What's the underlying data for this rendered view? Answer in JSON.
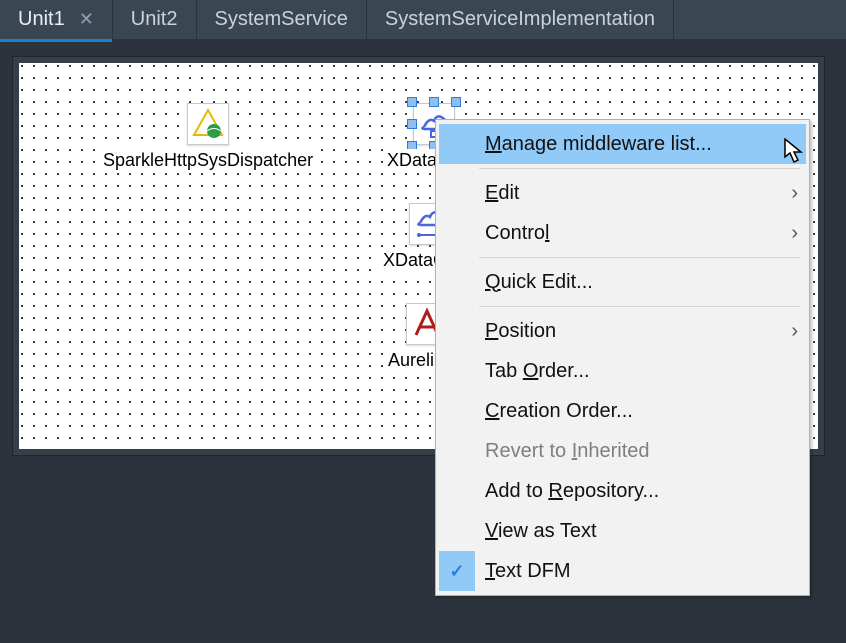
{
  "tabs": {
    "items": [
      {
        "label": "Unit1",
        "active": true,
        "closable": true
      },
      {
        "label": "Unit2",
        "active": false,
        "closable": false
      },
      {
        "label": "SystemService",
        "active": false,
        "closable": false
      },
      {
        "label": "SystemServiceImplementation",
        "active": false,
        "closable": false
      }
    ]
  },
  "designer": {
    "components": {
      "dispatcher": {
        "label": "SparkleHttpSysDispatcher"
      },
      "xdata": {
        "label": "XData"
      },
      "xdataconn": {
        "label": "XDataConn"
      },
      "aurelius": {
        "label": "AureliusC"
      }
    }
  },
  "contextMenu": {
    "items": {
      "manage_mw": {
        "pref": "M",
        "rest": "anage middleware list..."
      },
      "edit": {
        "pref": "E",
        "rest": "dit"
      },
      "control": {
        "pref": "",
        "rest": "Contro",
        "suf": "l"
      },
      "quick_edit": {
        "pref": "Q",
        "rest": "uick Edit..."
      },
      "position": {
        "pref": "P",
        "rest": "osition"
      },
      "tab_order": {
        "pref": "",
        "rest": "Tab ",
        "mid": "O",
        "tail": "rder..."
      },
      "creation": {
        "pref": "C",
        "rest": "reation Order..."
      },
      "revert": {
        "pref": "",
        "rest": "Revert to ",
        "mid": "I",
        "tail": "nherited"
      },
      "add_repo": {
        "pref": "",
        "rest": "Add to ",
        "mid": "R",
        "tail": "epository..."
      },
      "view_text": {
        "pref": "V",
        "rest": "iew as Text"
      },
      "text_dfm": {
        "pref": "T",
        "rest": "ext DFM"
      }
    },
    "checkedItem": "text_dfm",
    "check_glyph": "✓",
    "arrow_glyph": "›"
  }
}
